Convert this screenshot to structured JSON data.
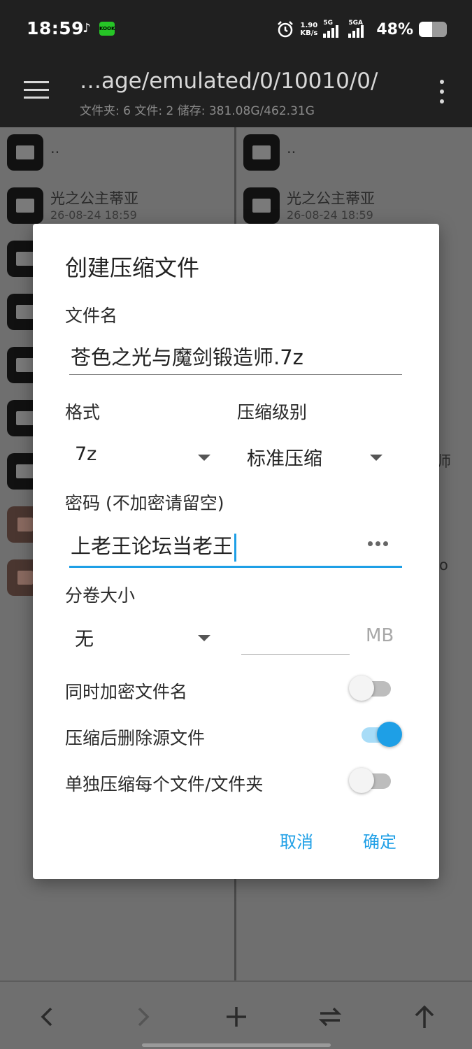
{
  "status_bar": {
    "time": "18:59",
    "net_speed_value": "1.90",
    "net_speed_unit": "KB/s",
    "signal1_label": "5G",
    "signal2_label": "5GA",
    "battery_text": "48%",
    "battery_level": 0.48,
    "icons": [
      "tiktok-icon",
      "app-notification-icon",
      "alarm-icon",
      "signal-icon",
      "battery-icon"
    ]
  },
  "toolbar": {
    "path": "…age/emulated/0/10010/0/",
    "info": "文件夹: 6  文件: 2  储存: 381.08G/462.31G"
  },
  "left_pane": {
    "items": [
      {
        "name": "..",
        "date": ""
      },
      {
        "name": "光之公主蒂亚",
        "date": "26-08-24 18:59"
      }
    ]
  },
  "right_pane": {
    "items": [
      {
        "name": "..",
        "date": ""
      },
      {
        "name": "光之公主蒂亚",
        "date": "26-08-24 18:59"
      }
    ],
    "peek_1": "师",
    "peek_2": "o"
  },
  "dialog": {
    "title": "创建压缩文件",
    "filename_label": "文件名",
    "filename_value": "苍色之光与魔剑锻造师.7z",
    "format_label": "格式",
    "format_value": "7z",
    "level_label": "压缩级别",
    "level_value": "标准压缩",
    "password_label": "密码 (不加密请留空)",
    "password_value": "上老王论坛当老王",
    "volume_label": "分卷大小",
    "volume_value": "无",
    "volume_unit": "MB",
    "toggles": [
      {
        "label": "同时加密文件名",
        "on": false
      },
      {
        "label": "压缩后删除源文件",
        "on": true
      },
      {
        "label": "单独压缩每个文件/文件夹",
        "on": false
      }
    ],
    "cancel_label": "取消",
    "confirm_label": "确定"
  }
}
